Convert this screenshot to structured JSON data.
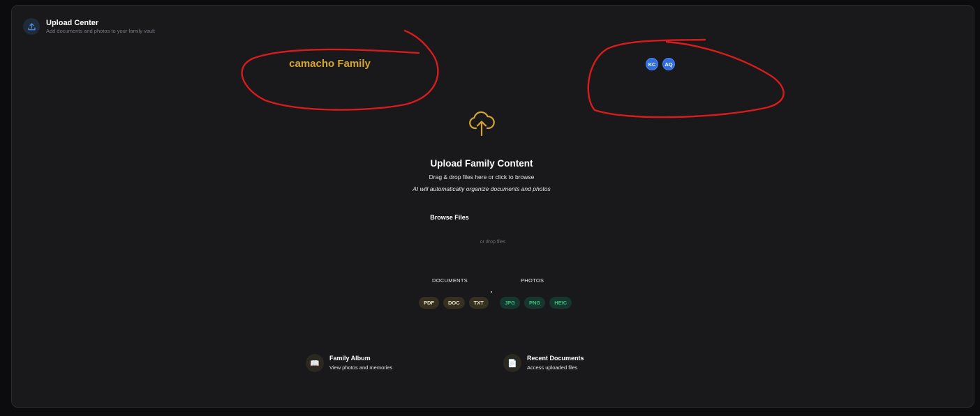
{
  "header": {
    "title": "Upload Center",
    "subtitle": "Add documents and photos to your family vault",
    "icon": "upload-icon"
  },
  "family": {
    "name": "camacho Family"
  },
  "members": [
    {
      "initials": "KC"
    },
    {
      "initials": "AQ"
    }
  ],
  "upload": {
    "icon": "cloud-upload-icon",
    "title": "Upload Family Content",
    "drag_text": "Drag & drop files here or click to browse",
    "ai_text": "AI will automatically organize documents and photos",
    "browse_label": "Browse Files",
    "or_drop": "or drop files"
  },
  "types": {
    "documents_label": "DOCUMENTS",
    "photos_label": "PHOTOS",
    "documents": [
      "PDF",
      "DOC",
      "TXT"
    ],
    "photos": [
      "JPG",
      "PNG",
      "HEIC"
    ]
  },
  "links": [
    {
      "title": "Family Album",
      "subtitle": "View photos and memories",
      "icon": "book-icon"
    },
    {
      "title": "Recent Documents",
      "subtitle": "Access uploaded files",
      "icon": "document-icon"
    }
  ],
  "colors": {
    "accent": "#d4a531",
    "avatar": "#2f6de0",
    "photo_chip_text": "#3ebd7b",
    "annotation": "#d81c1c"
  }
}
